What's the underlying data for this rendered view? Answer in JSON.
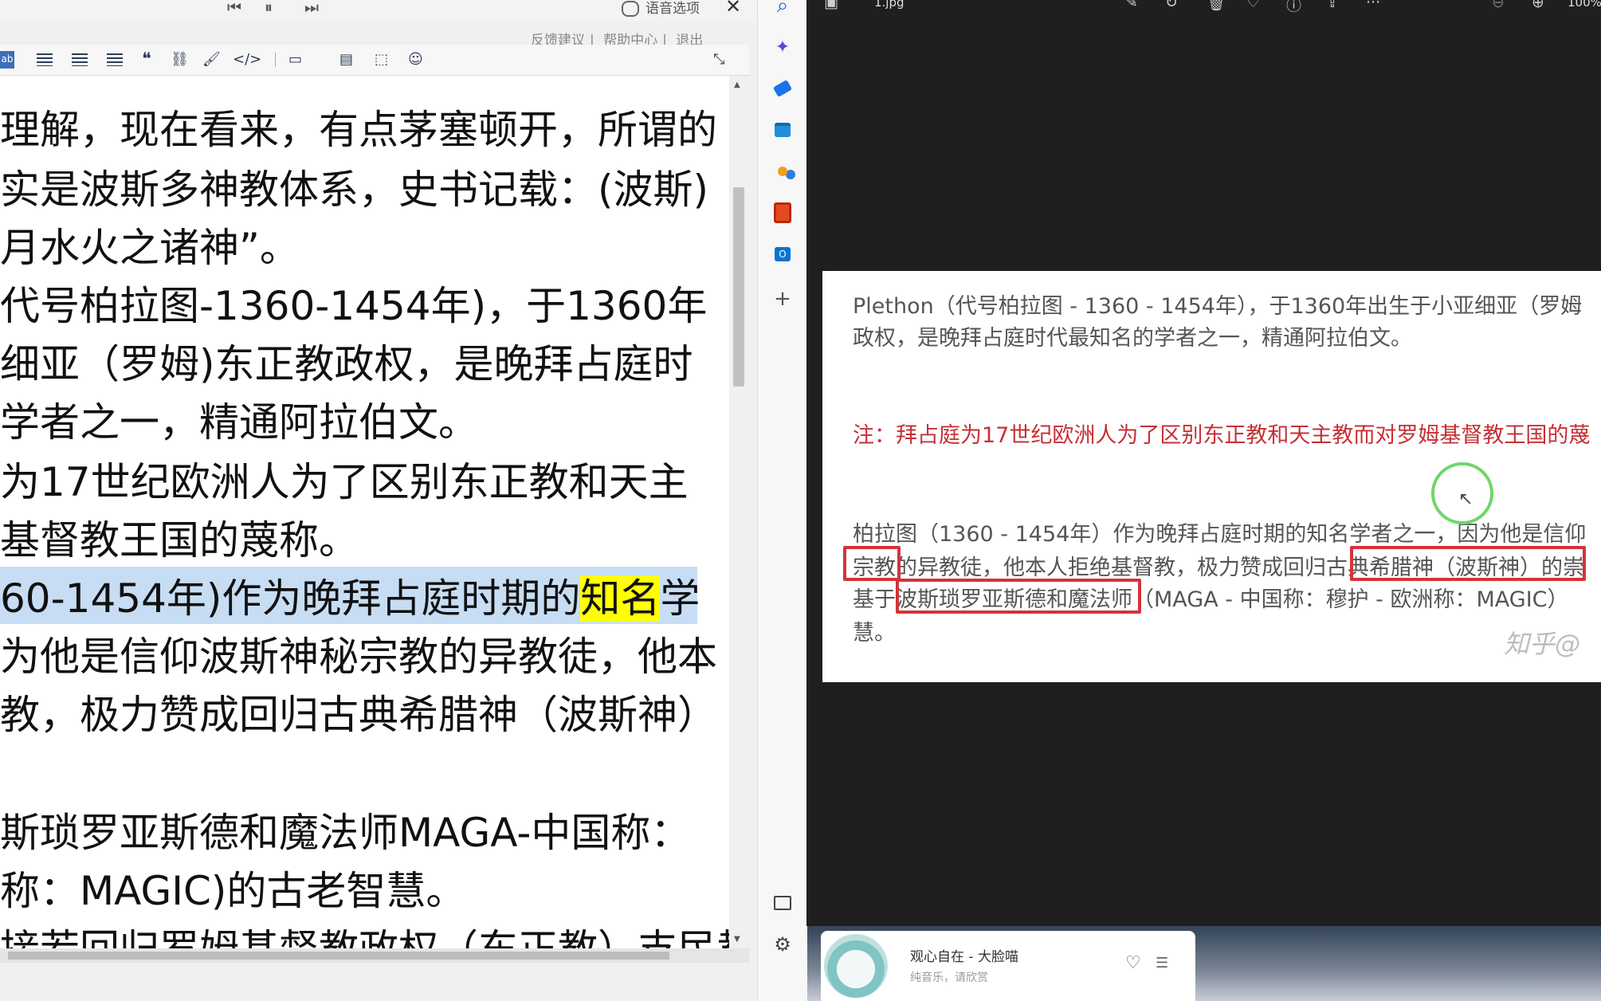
{
  "editor": {
    "voice_option": "语音选项",
    "header_links": [
      "反馈建议",
      "帮助中心",
      "退出"
    ],
    "toolbar": {
      "ab_label": "ab",
      "quote_label": "❝",
      "link_label": "⛓",
      "code_label": "</>"
    },
    "lines": [
      {
        "text": "理解，现在看来，有点茅塞顿开，所谓的"
      },
      {
        "text": "实是波斯多神教体系，史书记载：(波斯)"
      },
      {
        "text": "月水火之诸神”。"
      },
      {
        "text": "代号柏拉图-1360-1454年)，于1360年"
      },
      {
        "text": "细亚（罗姆)东正教政权，是晚拜占庭时"
      },
      {
        "text": "学者之一，精通阿拉伯文。"
      },
      {
        "text": "为17世纪欧洲人为了区别东正教和天主"
      },
      {
        "text": "基督教王国的蔑称。"
      },
      {
        "pre": "60-1454年)作为晚拜占庭时期的",
        "mark": "知名",
        "post": "学"
      },
      {
        "text": "为他是信仰波斯神秘宗教的异教徒，他本"
      },
      {
        "text": "教，极力赞成回归古典希腊神（波斯神）"
      },
      {
        "text": ""
      },
      {
        "text": "斯琐罗亚斯德和魔法师MAGA-中国称："
      },
      {
        "text": "称：MAGIC)的古老智慧。"
      },
      {
        "text": "接若回归罗姆基督教政权（东正教）支民教"
      }
    ]
  },
  "viewer": {
    "filename": "1.jpg",
    "zoom": "100%",
    "image_lines": [
      "Plethon（代号柏拉图 - 1360 - 1454年），于1360年出生于小亚细亚（罗姆",
      "政权，是晚拜占庭时代最知名的学者之一，精通阿拉伯文。",
      "注：拜占庭为17世纪欧洲人为了区别东正教和天主教而对罗姆基督教王国的蔑",
      "柏拉图（1360 - 1454年）作为晚拜占庭时期的知名学者之一，因为他是信仰",
      "宗教的异教徒，他本人拒绝基督教，极力赞成回归古典希腊神（波斯神）的崇",
      "基于波斯琐罗亚斯德和魔法师（MAGA - 中国称：穆护 - 欧洲称：MAGIC）",
      "慧。"
    ],
    "watermark": "知乎@"
  },
  "music": {
    "title": "观心自在 - 大脸喵",
    "subtitle": "纯音乐，请欣赏"
  }
}
